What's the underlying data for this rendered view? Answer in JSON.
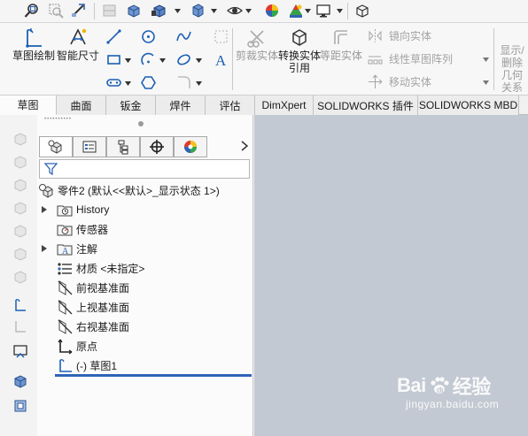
{
  "toolbar_top": {
    "icons": [
      "zoom-fit-icon",
      "zoom-area-icon",
      "previous-view-icon",
      "section-view-icon",
      "view-orientation-icon",
      "display-style-icon",
      "hide-show-icon",
      "edit-appearance-icon",
      "apply-scene-icon",
      "view-settings-icon",
      "view-cube-icon"
    ]
  },
  "ribbon": {
    "sketch_label": "草图绘制",
    "smart_dim_label": "智能尺寸",
    "trim_label": "剪裁实体",
    "convert_label": "转换实体引用",
    "offset_label": "等距实体",
    "mirror_label": "镜向实体",
    "linear_pattern_label": "线性草图阵列",
    "move_label": "移动实体",
    "display_delete_label": "显示/删除几何关系"
  },
  "tabs": [
    {
      "label": "草图",
      "active": true
    },
    {
      "label": "曲面"
    },
    {
      "label": "钣金"
    },
    {
      "label": "焊件"
    },
    {
      "label": "评估"
    },
    {
      "label": "DimXpert"
    },
    {
      "label": "SOLIDWORKS 插件"
    },
    {
      "label": "SOLIDWORKS MBD"
    }
  ],
  "tree": {
    "root": "零件2  (默认<<默认>_显示状态 1>)",
    "items": [
      {
        "label": "History",
        "icon": "history-folder-icon",
        "expandable": true
      },
      {
        "label": "传感器",
        "icon": "sensors-icon",
        "expandable": false
      },
      {
        "label": "注解",
        "icon": "annotations-icon",
        "expandable": true
      },
      {
        "label": "材质 <未指定>",
        "icon": "material-icon",
        "expandable": false
      },
      {
        "label": "前视基准面",
        "icon": "plane-icon",
        "expandable": false
      },
      {
        "label": "上视基准面",
        "icon": "plane-icon",
        "expandable": false
      },
      {
        "label": "右视基准面",
        "icon": "plane-icon",
        "expandable": false
      },
      {
        "label": "原点",
        "icon": "origin-icon",
        "expandable": false
      },
      {
        "label": "(-) 草图1",
        "icon": "sketch-icon",
        "expandable": false
      }
    ]
  },
  "watermark": {
    "logo_left": "Bai",
    "logo_right": "经验",
    "url": "jingyan.baidu.com"
  },
  "colors": {
    "graphics_bg": "#c3c9d2",
    "selection_line": "#2f64b5",
    "sketch_blue": "#1a5fb4"
  }
}
